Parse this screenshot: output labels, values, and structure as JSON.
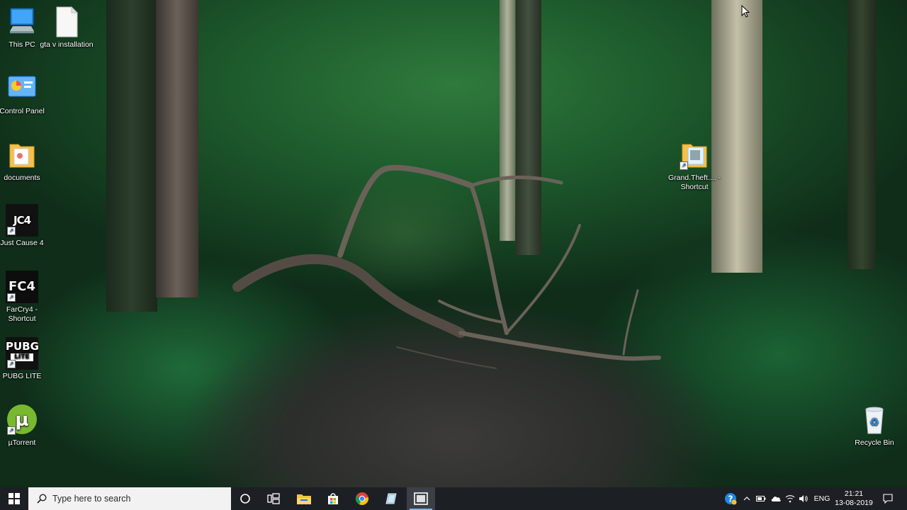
{
  "desktop": {
    "icons_left": [
      {
        "label": "This PC",
        "icon": "this-pc-icon"
      },
      {
        "label": "gta v installation",
        "icon": "text-file-icon"
      },
      {
        "label": "Control Panel",
        "icon": "control-panel-icon"
      },
      {
        "label": "documents",
        "icon": "folder-icon"
      },
      {
        "label": "Just Cause 4",
        "icon": "just-cause-4-icon",
        "badge": "JC4"
      },
      {
        "label": "FarCry4 - Shortcut",
        "icon": "farcry4-icon",
        "badge": "FC4"
      },
      {
        "label": "PUBG LITE",
        "icon": "pubg-lite-icon",
        "badge": "PUBG",
        "badge2": "LITE"
      },
      {
        "label": "µTorrent",
        "icon": "utorrent-icon"
      }
    ],
    "icons_right": [
      {
        "label": "Grand.Theft.... - Shortcut",
        "icon": "folder-shortcut-icon"
      },
      {
        "label": "Recycle Bin",
        "icon": "recycle-bin-icon"
      }
    ]
  },
  "taskbar": {
    "search_placeholder": "Type here to search",
    "pinned": [
      "cortana-icon",
      "task-view-icon",
      "file-explorer-icon",
      "store-icon",
      "chrome-icon",
      "app-icon",
      "screen-recorder-icon"
    ],
    "tray": {
      "language": "ENG",
      "time": "21:21",
      "date": "13-08-2019"
    }
  },
  "colors": {
    "taskbar": "#1c1f24",
    "search_bg": "#f2f2f2",
    "accent": "#7fb2e6"
  }
}
